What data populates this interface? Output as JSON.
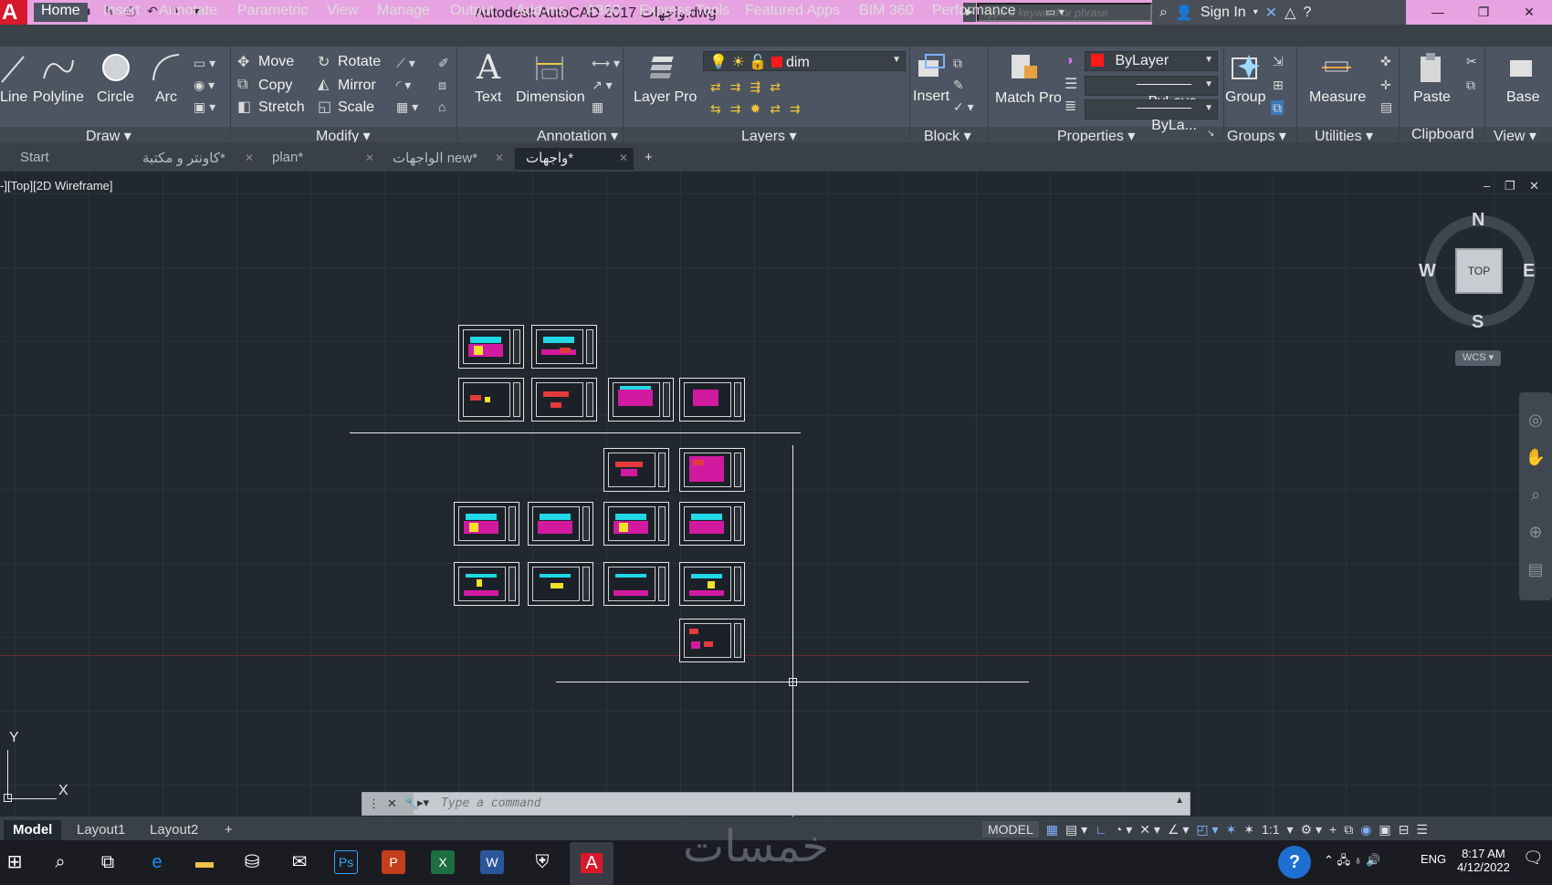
{
  "title_bar": {
    "app_icon": "A",
    "title": "Autodesk AutoCAD 2017    واجهات.dwg",
    "search_placeholder": "Type a keyword or phrase",
    "sign_in": "Sign In",
    "qat_icons": [
      "new-icon",
      "open-icon",
      "save-icon",
      "saveas-icon",
      "plot-icon",
      "undo-icon",
      "redo-icon"
    ]
  },
  "ribbon_tabs": [
    "Home",
    "Insert",
    "Annotate",
    "Parametric",
    "View",
    "Manage",
    "Output",
    "Add-ins",
    "A360",
    "Express Tools",
    "Featured Apps",
    "BIM 360",
    "Performance"
  ],
  "active_tab": "Home",
  "ribbon": {
    "draw": {
      "line": "Line",
      "polyline": "Polyline",
      "circle": "Circle",
      "arc": "Arc",
      "title": "Draw"
    },
    "modify": {
      "move": "Move",
      "rotate": "Rotate",
      "copy": "Copy",
      "mirror": "Mirror",
      "stretch": "Stretch",
      "scale": "Scale",
      "title": "Modify"
    },
    "annotation": {
      "text": "Text",
      "dimension": "Dimension",
      "title": "Annotation"
    },
    "layers": {
      "layer_properties": "Layer Properties",
      "current_layer": "dim",
      "title": "Layers"
    },
    "block": {
      "insert": "Insert",
      "title": "Block"
    },
    "properties": {
      "match": "Match Properties",
      "color": "ByLayer",
      "linetype": "ByLaye",
      "lineweight": "ByLa...",
      "title": "Properties"
    },
    "groups": {
      "group": "Group",
      "title": "Groups"
    },
    "utilities": {
      "measure": "Measure",
      "title": "Utilities"
    },
    "clipboard": {
      "paste": "Paste",
      "title": "Clipboard"
    },
    "view": {
      "base": "Base",
      "title": "View"
    }
  },
  "doc_tabs": [
    {
      "label": "Start"
    },
    {
      "label": "كاونتر و مكتبة*"
    },
    {
      "label": "plan*"
    },
    {
      "label": "الواجهات new*"
    },
    {
      "label": "واجهات*"
    }
  ],
  "viewport_label": "-][Top][2D Wireframe]",
  "viewcube": {
    "n": "N",
    "s": "S",
    "e": "E",
    "w": "W",
    "top": "TOP",
    "wcs": "WCS"
  },
  "ucs": {
    "x": "X",
    "y": "Y"
  },
  "command_line": {
    "placeholder": "Type a command"
  },
  "layout_tabs": [
    "Model",
    "Layout1",
    "Layout2"
  ],
  "status": {
    "model": "MODEL",
    "scale": "1:1"
  },
  "taskbar": {
    "lang": "ENG",
    "time": "8:17 AM",
    "date": "4/12/2022"
  },
  "watermark": "خمسات",
  "colors": {
    "accent_title": "#e7a3e1",
    "canvas": "#212830",
    "ribbon": "#4c5561"
  }
}
